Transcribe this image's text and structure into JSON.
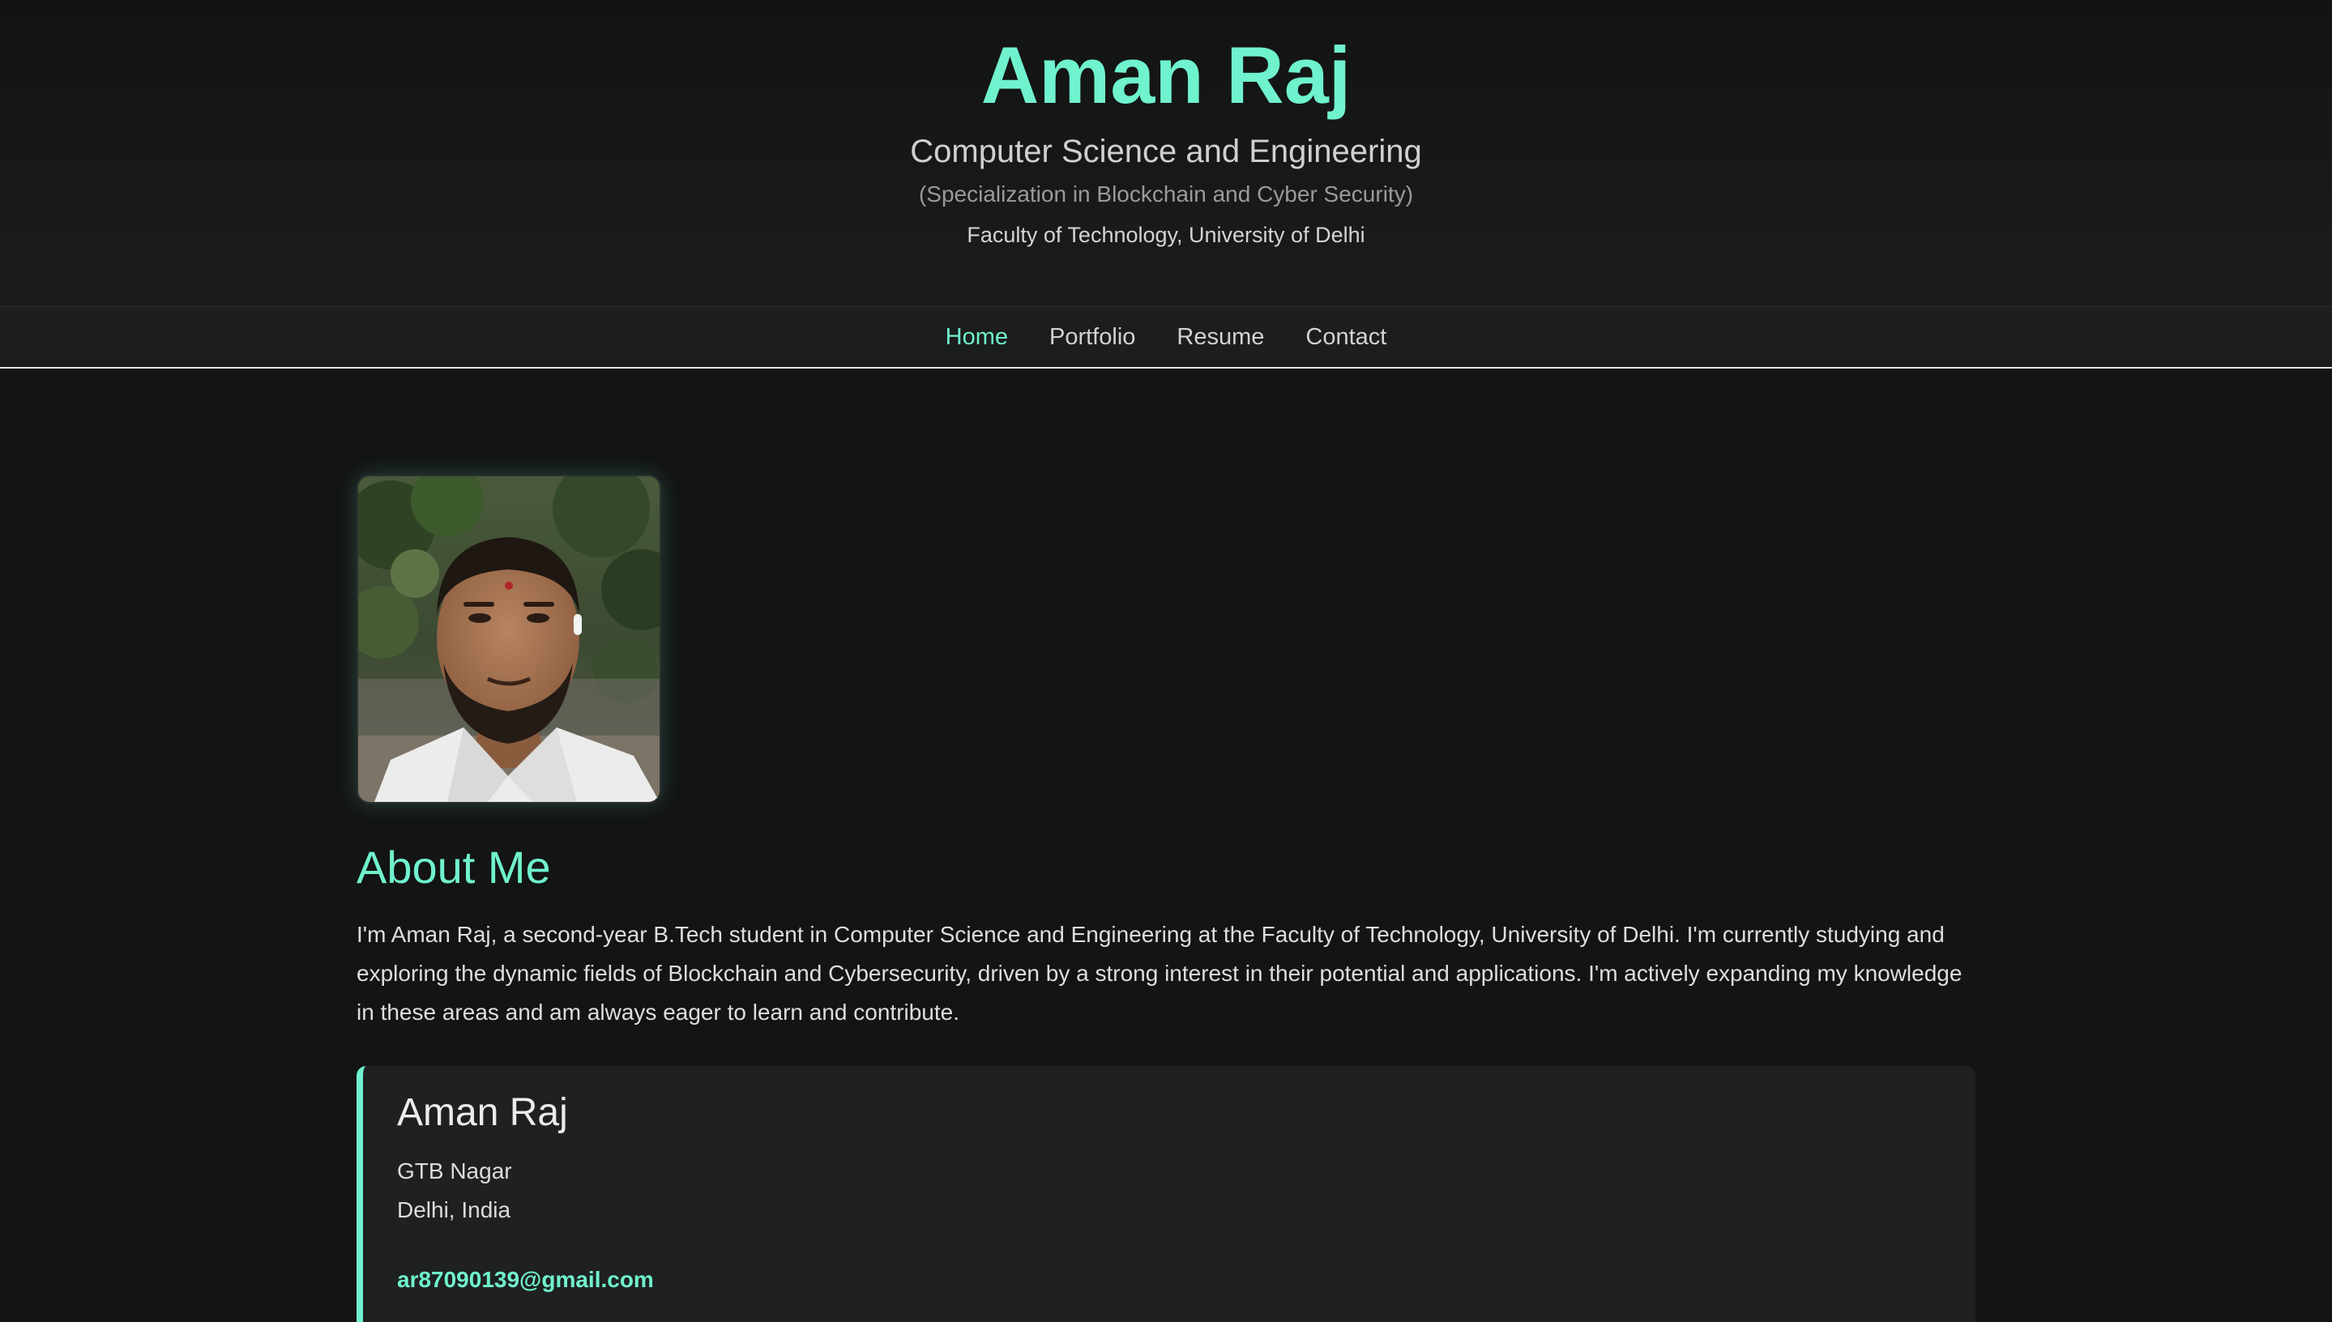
{
  "hero": {
    "name": "Aman Raj",
    "department": "Computer Science and Engineering",
    "specialization": "(Specialization in Blockchain and Cyber Security)",
    "faculty": "Faculty of Technology, University of Delhi"
  },
  "nav": {
    "items": [
      {
        "label": "Home",
        "active": true
      },
      {
        "label": "Portfolio",
        "active": false
      },
      {
        "label": "Resume",
        "active": false
      },
      {
        "label": "Contact",
        "active": false
      }
    ]
  },
  "about": {
    "title": "About Me",
    "text": "I'm Aman Raj, a second-year B.Tech student in Computer Science and Engineering at the Faculty of Technology, University of Delhi. I'm currently studying and exploring the dynamic fields of Blockchain and Cybersecurity, driven by a strong interest in their potential and applications. I'm actively expanding my knowledge in these areas and am always eager to learn and contribute."
  },
  "contact_card": {
    "name": "Aman Raj",
    "address_line1": "GTB Nagar",
    "address_line2": "Delhi, India",
    "email": "ar87090139@gmail.com"
  },
  "colors": {
    "accent": "#6ff2cd",
    "background": "#131414",
    "card": "#1f2020"
  }
}
